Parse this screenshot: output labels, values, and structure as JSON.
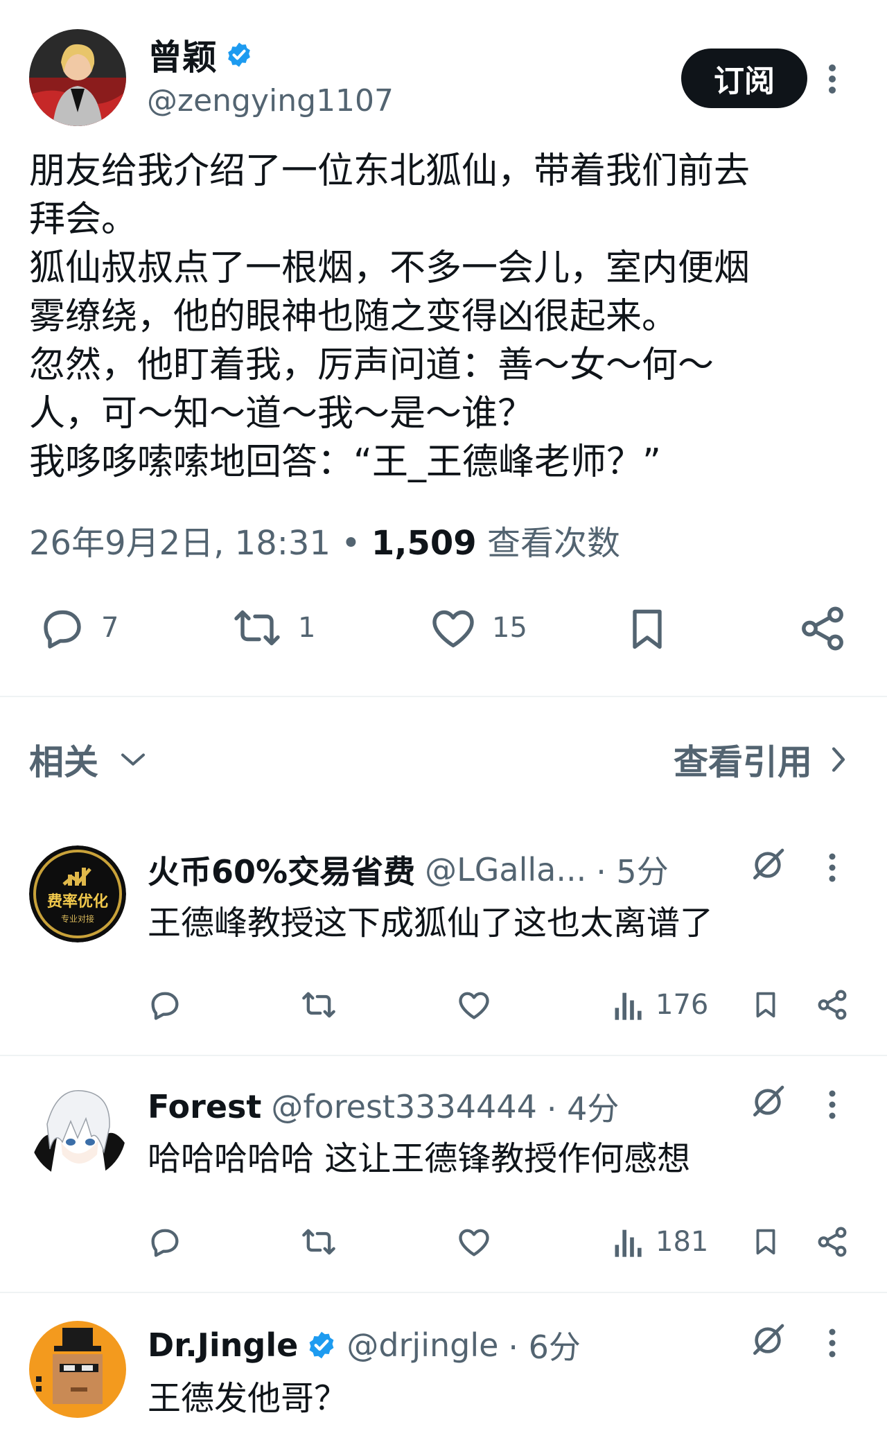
{
  "main_tweet": {
    "author_name": "曾颖",
    "author_handle": "@zengying1107",
    "verified": true,
    "subscribe_label": "订阅",
    "body_lines": [
      "朋友给我介绍了一位东北狐仙，带着我们前去",
      "拜会。",
      "狐仙叔叔点了一根烟，不多一会儿，室内便烟",
      "雾缭绕，他的眼神也随之变得凶很起来。",
      "忽然，他盯着我，厉声问道：善～女～何～",
      "人，可～知～道～我～是～谁？",
      "我哆哆嗦嗦地回答：“王_王德峰老师？”"
    ],
    "timestamp": "26年9月2日, 18:31",
    "separator": "•",
    "views_count": "1,509",
    "views_label": "查看次数",
    "actions": {
      "reply_count": "7",
      "retweet_count": "1",
      "like_count": "15"
    }
  },
  "related": {
    "label": "相关",
    "quotes_label": "查看引用"
  },
  "replies": [
    {
      "author_name": "火币60%交易省费",
      "author_handle": "@LGalla...",
      "time": "· 5分",
      "text": "王德峰教授这下成狐仙了这也太离谱了",
      "views": "176",
      "avatar_text": "费率优化",
      "avatar_subtext": "专业对接",
      "verified": false
    },
    {
      "author_name": "Forest",
      "author_handle": "@forest3334444",
      "time": "· 4分",
      "text": "哈哈哈哈哈 这让王德锋教授作何感想",
      "views": "181",
      "verified": false
    },
    {
      "author_name": "Dr.Jingle",
      "author_handle": "@drjingle",
      "time": "· 6分",
      "text": "王德发他哥？",
      "verified": true
    }
  ],
  "colors": {
    "text_primary": "#0f1419",
    "text_secondary": "#536471",
    "verified_blue": "#1d9bf0",
    "divider": "#eff3f4",
    "button_bg": "#0f1419"
  },
  "icons": [
    "verified-badge-icon",
    "more-icon",
    "reply-icon",
    "retweet-icon",
    "like-icon",
    "bookmark-icon",
    "share-icon",
    "chevron-down-icon",
    "chevron-right-icon",
    "grok-icon",
    "views-icon"
  ]
}
